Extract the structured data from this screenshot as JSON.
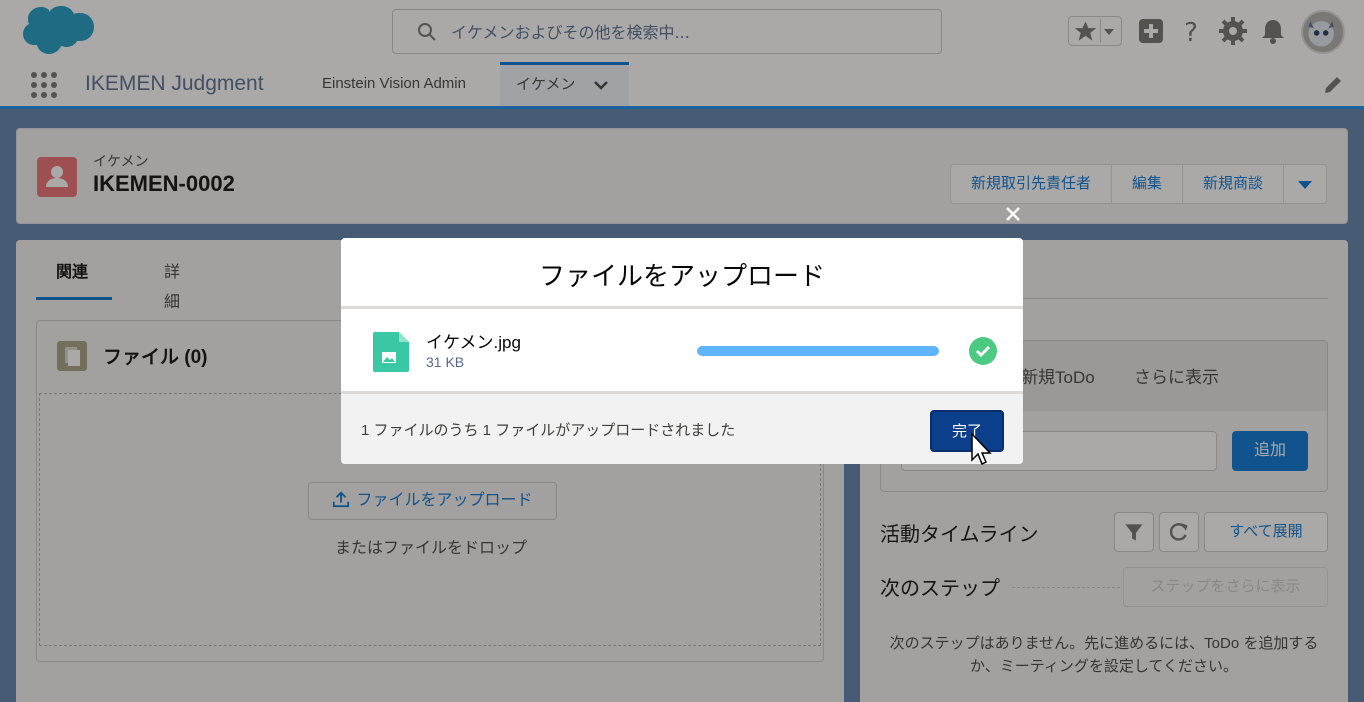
{
  "search": {
    "placeholder": "イケメンおよびその他を検索中..."
  },
  "app_nav": {
    "app_name": "IKEMEN Judgment",
    "items": [
      {
        "label": "Einstein Vision Admin"
      },
      {
        "label": "イケメン"
      }
    ]
  },
  "record": {
    "type": "イケメン",
    "name": "IKEMEN-0002",
    "actions": [
      "新規取引先責任者",
      "編集",
      "新規商談"
    ]
  },
  "left_tabs": [
    "関連",
    "詳細"
  ],
  "files": {
    "title": "ファイル (0)",
    "upload_label": "ファイルをアップロード",
    "drop_text": "またはファイルをドロップ"
  },
  "activity": {
    "tabs": [
      "新規ToDo",
      "さらに表示"
    ],
    "add_label": "追加",
    "timeline_title": "活動タイムライン",
    "expand_all": "すべて展開",
    "next_steps_title": "次のステップ",
    "more_steps": "ステップをさらに表示",
    "empty_message": "次のステップはありません。先に進めるには、ToDo を追加するか、ミーティングを設定してください。"
  },
  "modal": {
    "title": "ファイルをアップロード",
    "file_name": "イケメン.jpg",
    "file_size": "31 KB",
    "progress": 1.0,
    "footer_text": "1 ファイルのうち 1 ファイルがアップロードされました",
    "done_label": "完了"
  },
  "colors": {
    "brand_blue": "#0070d2",
    "progress_fill": "#5eb4ff",
    "success_green": "#4bca81",
    "record_icon": "#e9696e"
  }
}
